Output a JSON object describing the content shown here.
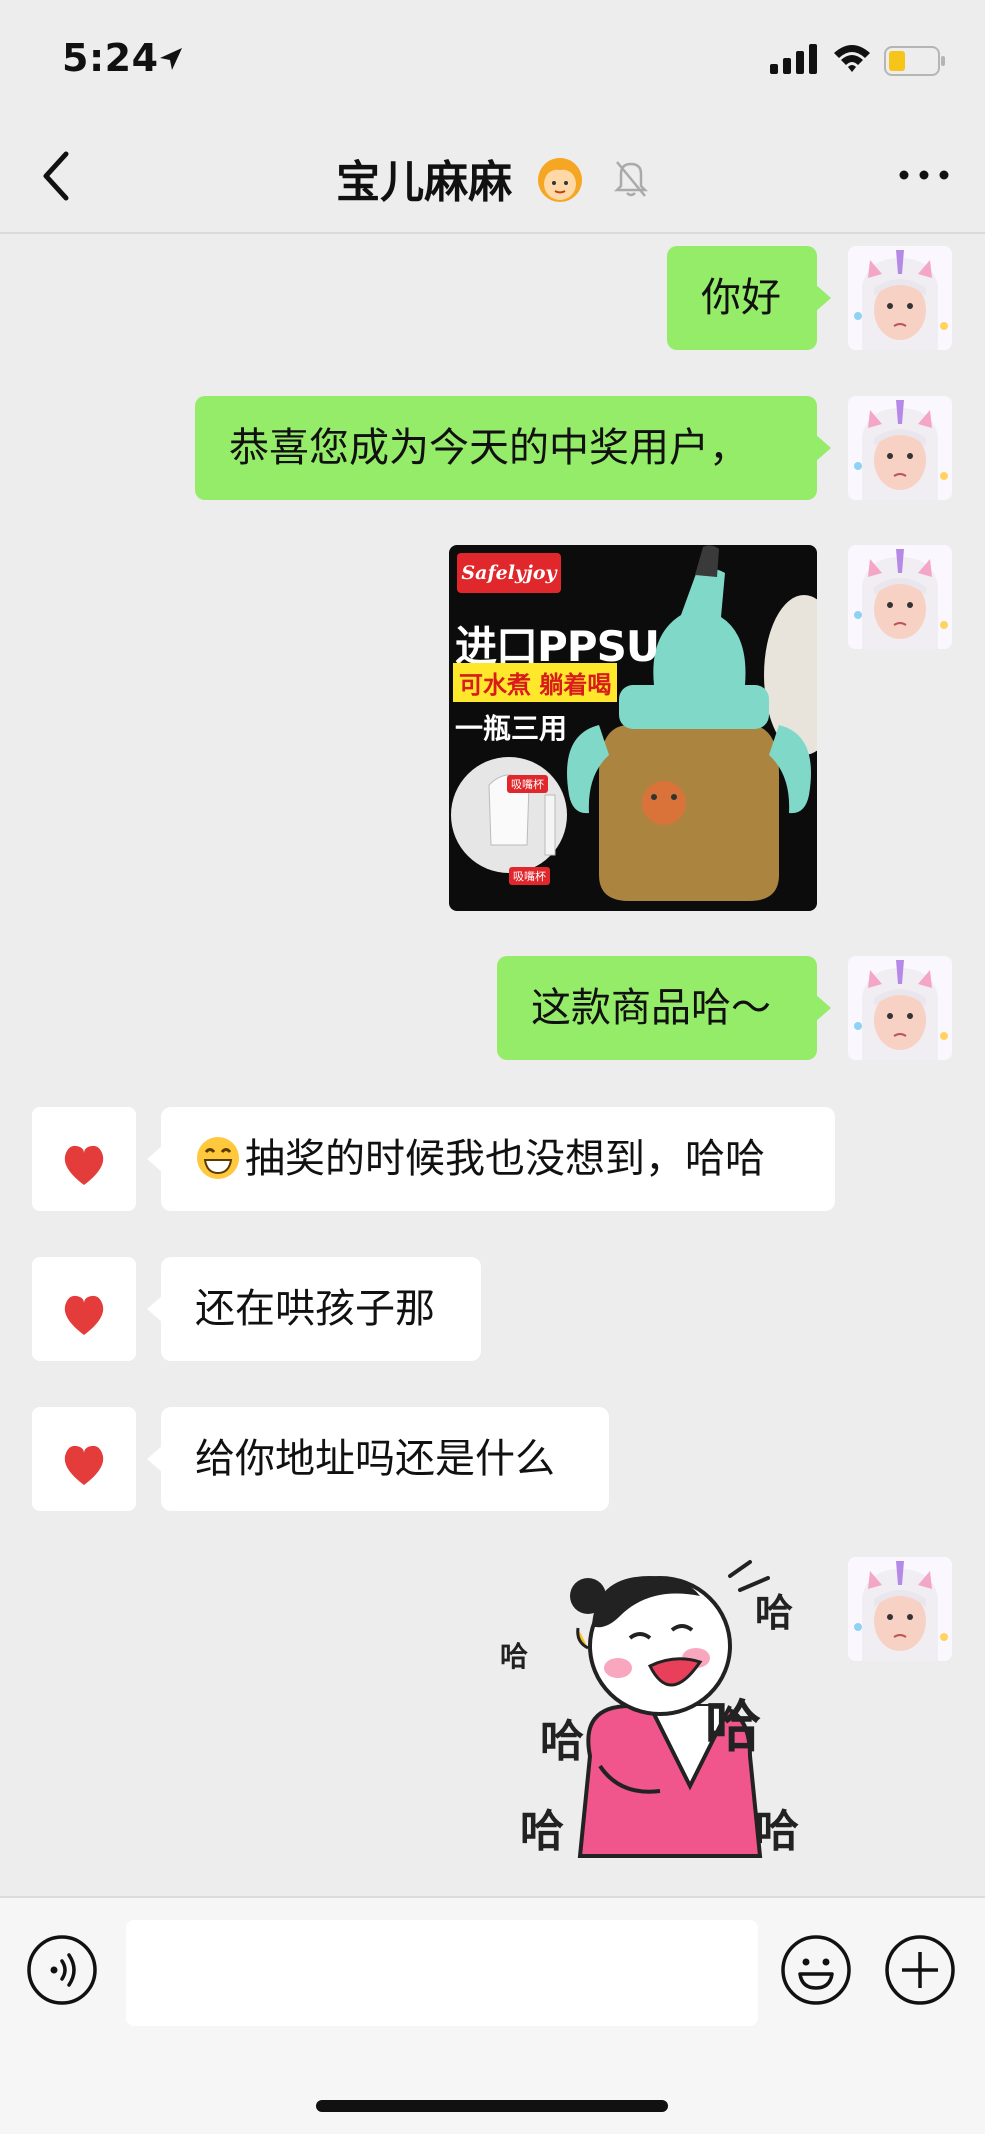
{
  "status_bar": {
    "time": "5:24",
    "battery_color": "#F7C41A"
  },
  "nav": {
    "title": "宝儿麻麻"
  },
  "messages": [
    {
      "side": "right",
      "type": "text",
      "text": "你好"
    },
    {
      "side": "right",
      "type": "text",
      "text": "恭喜您成为今天的中奖用户，"
    },
    {
      "side": "right",
      "type": "image",
      "product": {
        "brand": "Safelyjoy",
        "line1": "进口PPSU",
        "line2": "可水煮 躺着喝",
        "line3": "一瓶三用",
        "tag1": "吸嘴杯",
        "tag2": "吸嘴杯"
      }
    },
    {
      "side": "right",
      "type": "text",
      "text": "这款商品哈～"
    },
    {
      "side": "left",
      "type": "text",
      "emoji": "grin-icon",
      "text": "抽奖的时候我也没想到，哈哈"
    },
    {
      "side": "left",
      "type": "text",
      "text": "还在哄孩子那"
    },
    {
      "side": "left",
      "type": "text",
      "text": "给你地址吗还是什么"
    },
    {
      "side": "right",
      "type": "sticker",
      "sticker": {
        "laugh": "哈"
      }
    }
  ],
  "colors": {
    "outgoing_bubble": "#95EC69",
    "incoming_bubble": "#FFFFFF",
    "background": "#EDEDED"
  },
  "input": {
    "placeholder": ""
  }
}
